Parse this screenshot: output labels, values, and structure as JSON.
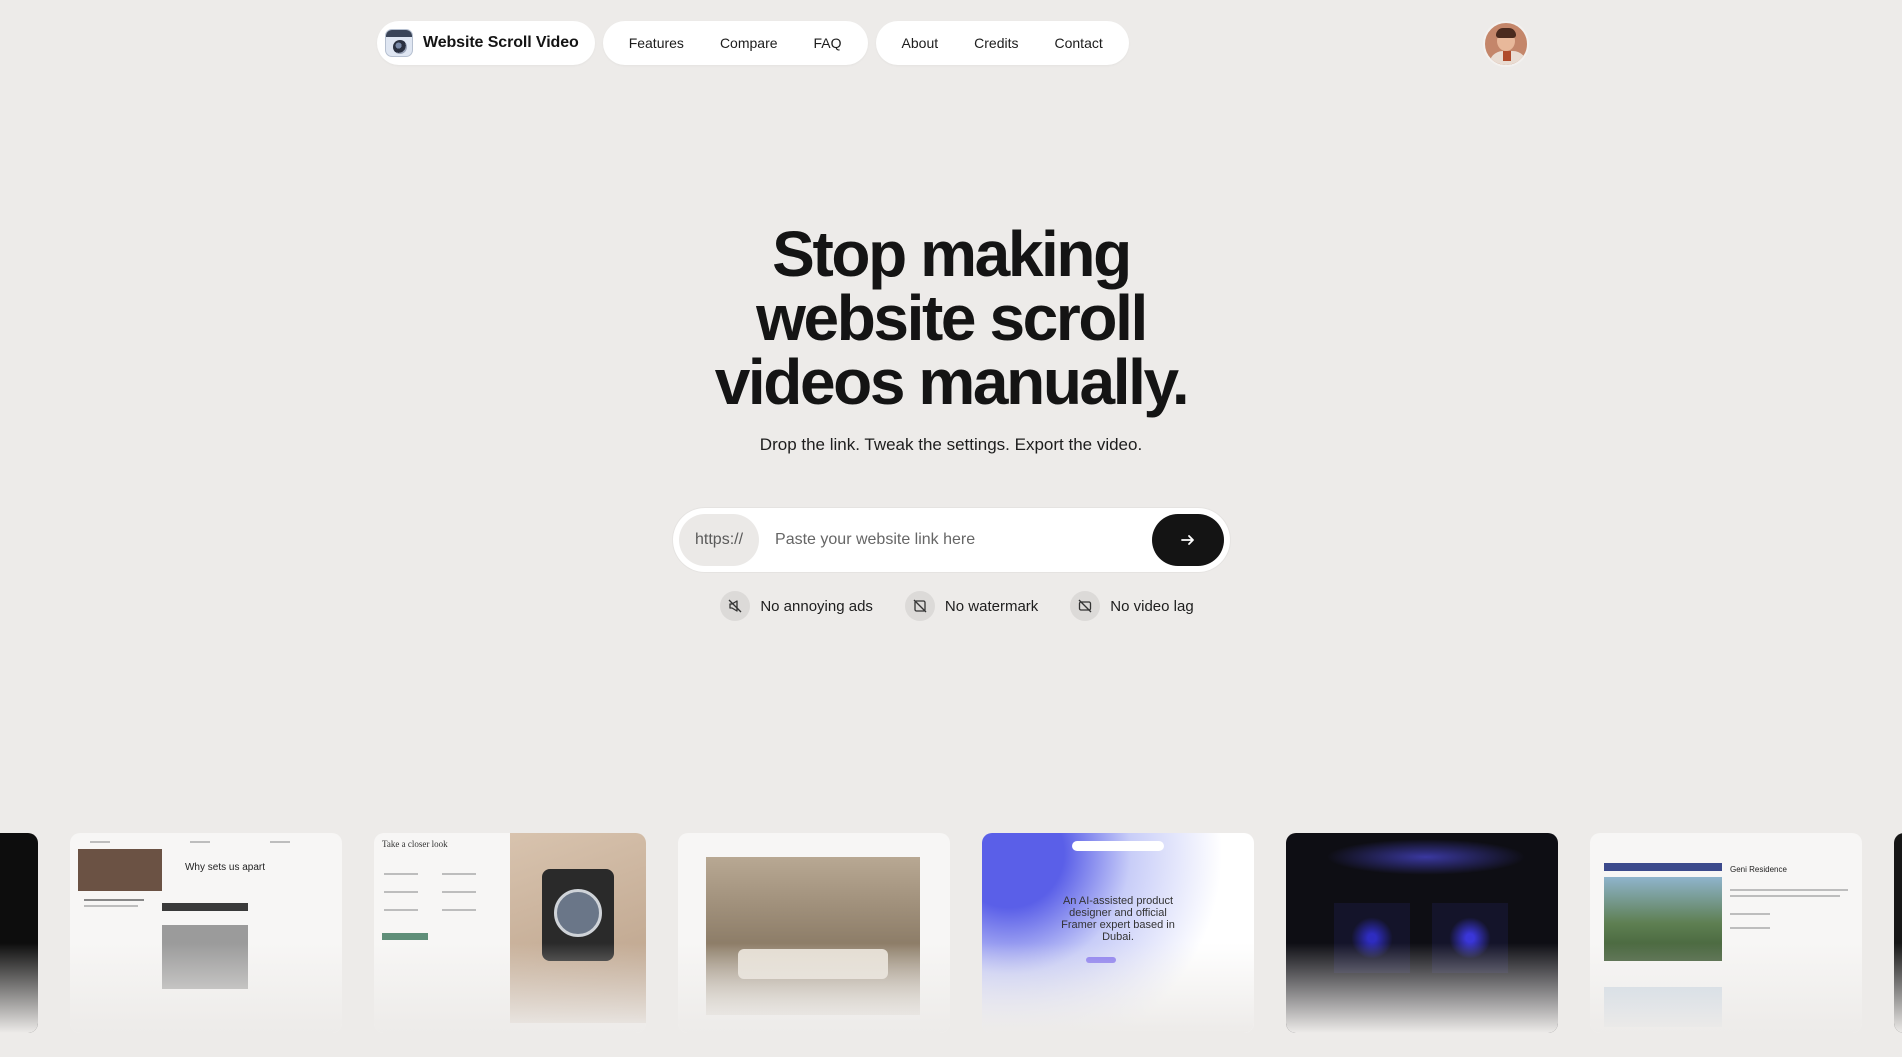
{
  "nav": {
    "brand": "Website Scroll Video",
    "group1": [
      "Features",
      "Compare",
      "FAQ"
    ],
    "group2": [
      "About",
      "Credits",
      "Contact"
    ]
  },
  "hero": {
    "title_lines": [
      "Stop making",
      "website scroll",
      "videos manually."
    ],
    "subtitle": "Drop the link. Tweak the settings. Export the video."
  },
  "url_form": {
    "prefix": "https://",
    "placeholder": "Paste your website link here",
    "submit_icon": "arrow-right-icon"
  },
  "features": [
    {
      "label": "No annoying ads",
      "icon": "no-ads-icon"
    },
    {
      "label": "No watermark",
      "icon": "no-watermark-icon"
    },
    {
      "label": "No video lag",
      "icon": "no-video-lag-icon"
    }
  ],
  "gallery": {
    "thumb1": {
      "heading": "Why sets us apart"
    },
    "thumb2": {
      "heading": "Take a closer look"
    },
    "thumb4": {
      "heading": "An AI-assisted product designer and official Framer expert based in Dubai."
    },
    "thumb6": {
      "heading": "Geni Residence"
    }
  }
}
